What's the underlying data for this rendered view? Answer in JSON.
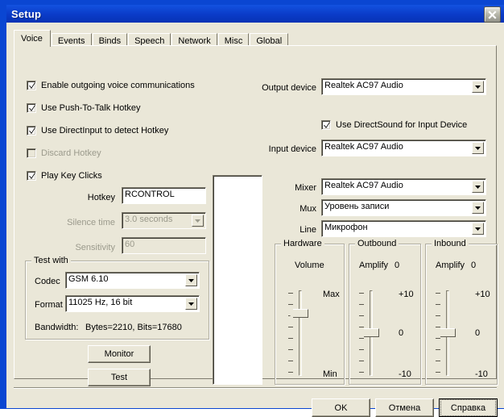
{
  "window": {
    "title": "Setup",
    "close_icon": "close-icon",
    "titlebar_color": "#0a3bc8",
    "face_color": "#eae7d8"
  },
  "tabs": [
    {
      "label": "Voice",
      "selected": true
    },
    {
      "label": "Events",
      "selected": false
    },
    {
      "label": "Binds",
      "selected": false
    },
    {
      "label": "Speech",
      "selected": false
    },
    {
      "label": "Network",
      "selected": false
    },
    {
      "label": "Misc",
      "selected": false
    },
    {
      "label": "Global",
      "selected": false
    }
  ],
  "left": {
    "checkboxes": [
      {
        "label": "Enable outgoing voice communications",
        "checked": true,
        "enabled": true
      },
      {
        "label": "Use Push-To-Talk Hotkey",
        "checked": true,
        "enabled": true
      },
      {
        "label": "Use DirectInput to detect Hotkey",
        "checked": true,
        "enabled": true
      },
      {
        "label": "Discard Hotkey",
        "checked": false,
        "enabled": false
      },
      {
        "label": "Play Key Clicks",
        "checked": true,
        "enabled": true
      }
    ],
    "hotkey_label": "Hotkey",
    "hotkey_value": "RCONTROL",
    "silence_label": "Silence time",
    "silence_value": "3.0 seconds",
    "sensitivity_label": "Sensitivity",
    "sensitivity_value": "60",
    "testwith": {
      "title": "Test with",
      "codec_label": "Codec",
      "codec_value": "GSM 6.10",
      "format_label": "Format",
      "format_value": "11025 Hz, 16 bit",
      "bandwidth_label": "Bandwidth:",
      "bandwidth_value": "Bytes=2210, Bits=17680"
    },
    "monitor_button": "Monitor",
    "test_button": "Test"
  },
  "right": {
    "output_device_label": "Output device",
    "output_device_value": "Realtek AC97 Audio",
    "directsound_label": "Use DirectSound for Input Device",
    "directsound_checked": true,
    "input_device_label": "Input device",
    "input_device_value": "Realtek AC97 Audio",
    "mixer_label": "Mixer",
    "mixer_value": "Realtek AC97 Audio",
    "mux_label": "Mux",
    "mux_value": "Уровень записи",
    "line_label": "Line",
    "line_value": "Микрофон"
  },
  "sliders": {
    "hardware": {
      "group_title": "Hardware",
      "caption": "Volume",
      "top_label": "Max",
      "mid_label": "",
      "bottom_label": "Min",
      "value_text": "",
      "thumb_pct": 22
    },
    "outbound": {
      "group_title": "Outbound",
      "caption": "Amplify",
      "value_text": "0",
      "top_label": "+10",
      "mid_label": "0",
      "bottom_label": "-10",
      "thumb_pct": 50
    },
    "inbound": {
      "group_title": "Inbound",
      "caption": "Amplify",
      "value_text": "0",
      "top_label": "+10",
      "mid_label": "0",
      "bottom_label": "-10",
      "thumb_pct": 50
    }
  },
  "footer": {
    "ok_label": "OK",
    "cancel_label": "Отмена",
    "help_label": "Справка"
  }
}
